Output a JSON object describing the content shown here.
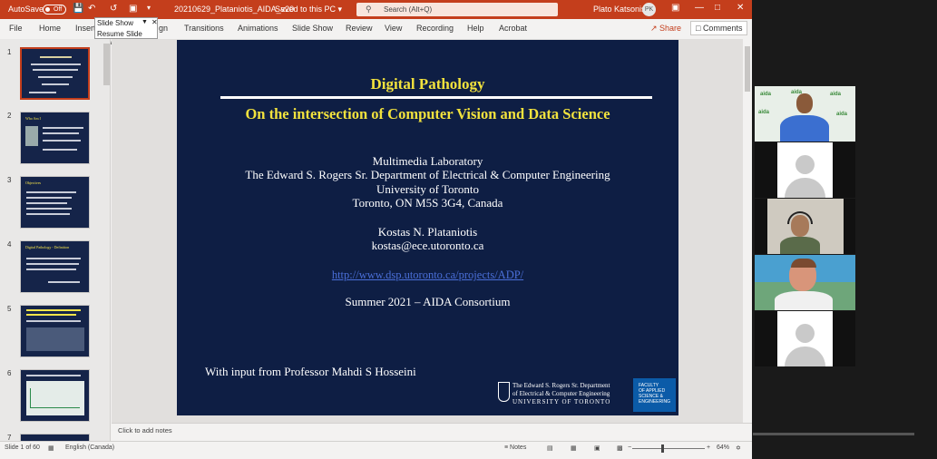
{
  "titlebar": {
    "autosave_label": "AutoSave",
    "autosave_state": "Off",
    "doc_title": "20210629_Plataniotis_AIDA_v20",
    "save_status": "Saved to this PC",
    "search_placeholder": "Search (Alt+Q)",
    "user_name": "Plato Katsonis",
    "user_initials": "PK"
  },
  "menu": {
    "items": [
      "File",
      "Home",
      "Insert",
      "Design",
      "Transitions",
      "Animations",
      "Slide Show",
      "Review",
      "View",
      "Recording",
      "Help",
      "Acrobat"
    ],
    "insert_visible": "Insert",
    "design_visible": "gn",
    "share_label": "Share",
    "comments_label": "Comments"
  },
  "slideshow_popup": {
    "title": "Slide Show",
    "resume": "Resume Slide Show"
  },
  "thumbnails": [
    {
      "num": "1",
      "heading": "Digital Pathology"
    },
    {
      "num": "2",
      "heading": "Who Am I"
    },
    {
      "num": "3",
      "heading": "Objectives"
    },
    {
      "num": "4",
      "heading": "Digital Pathology - Definition"
    },
    {
      "num": "5",
      "heading": "How Digital Pathology Connects to Computer Vision & Machine Learning?"
    },
    {
      "num": "6",
      "heading": "Digital Pathology in a Health Ecosystem Position"
    },
    {
      "num": "7",
      "heading": ""
    }
  ],
  "slide": {
    "title": "Digital Pathology",
    "subtitle": "On the intersection of Computer Vision and Data Science",
    "lines": [
      "Multimedia Laboratory",
      "The Edward S. Rogers Sr. Department of Electrical & Computer Engineering",
      "University of Toronto",
      "Toronto, ON M5S 3G4, Canada"
    ],
    "author": "Kostas N. Plataniotis",
    "email": "kostas@ece.utoronto.ca",
    "link": "http://www.dsp.utoronto.ca/projects/ADP/",
    "event": "Summer 2021 – AIDA Consortium",
    "input_note": "With input from Professor Mahdi S Hosseini",
    "uoft_line1": "The Edward S. Rogers Sr. Department",
    "uoft_line2": "of Electrical & Computer Engineering",
    "uoft_line3": "UNIVERSITY OF TORONTO",
    "fasa_l1": "FACULTY",
    "fasa_l2": "OF APPLIED",
    "fasa_l3": "SCIENCE &",
    "fasa_l4": "ENGINEERING"
  },
  "notes_placeholder": "Click to add notes",
  "statusbar": {
    "slide_info": "Slide 1 of 60",
    "language": "English (Canada)",
    "notes_label": "Notes",
    "zoom": "64%"
  },
  "video": {
    "tiles": [
      "speaker-logos",
      "placeholder",
      "person-headset",
      "person-main",
      "placeholder"
    ],
    "logo_text": "aida"
  }
}
